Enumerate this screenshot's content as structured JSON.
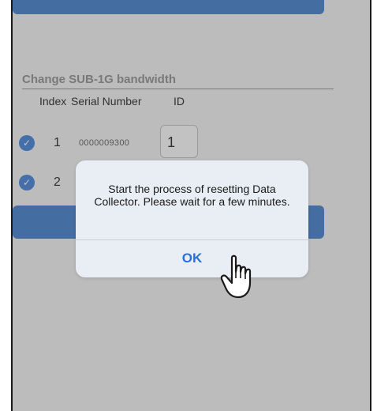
{
  "section": {
    "title": "Change SUB-1G bandwidth"
  },
  "columns": {
    "index": "Index",
    "serial": "Serial Number",
    "id": "ID"
  },
  "rows": [
    {
      "check": "✓",
      "index": "1",
      "serial": "0000009300",
      "id": "1"
    },
    {
      "check": "✓",
      "index": "2",
      "serial": "",
      "id": ""
    }
  ],
  "dialog": {
    "message": "Start the process of resetting Data Collector. Please wait for a few minutes.",
    "ok_label": "OK"
  },
  "icons": {
    "cursor": "pointing-hand-cursor-icon",
    "check": "checkmark-icon"
  },
  "colors": {
    "accent": "#3a78c8",
    "ok_text": "#2a6fdb"
  }
}
